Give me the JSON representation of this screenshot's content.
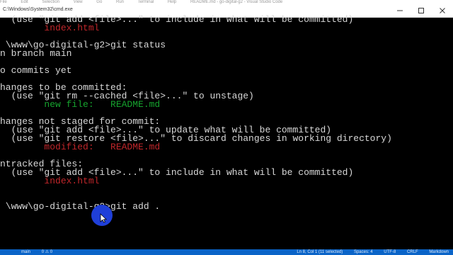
{
  "window": {
    "title": "C:\\Windows\\System32\\cmd.exe",
    "behind_labels": [
      "File",
      "Edit",
      "Selection",
      "View",
      "Go",
      "Run",
      "Terminal",
      "Help",
      "README.md - go-digital-g2 - Visual Studio Code"
    ]
  },
  "console": {
    "lines": [
      {
        "text": "  (use \"git add <file>...\" to include in what will be committed)",
        "color": "default"
      },
      {
        "text": "        index.html",
        "color": "red"
      },
      {
        "text": "",
        "color": "default"
      },
      {
        "text": " \\www\\go-digital-g2>git status",
        "color": "default"
      },
      {
        "text": "n branch main",
        "color": "default"
      },
      {
        "text": "",
        "color": "default"
      },
      {
        "text": "o commits yet",
        "color": "default"
      },
      {
        "text": "",
        "color": "default"
      },
      {
        "text": "hanges to be committed:",
        "color": "default"
      },
      {
        "text": "  (use \"git rm --cached <file>...\" to unstage)",
        "color": "default"
      },
      {
        "text": "        new file:   README.md",
        "color": "green"
      },
      {
        "text": "",
        "color": "default"
      },
      {
        "text": "hanges not staged for commit:",
        "color": "default"
      },
      {
        "text": "  (use \"git add <file>...\" to update what will be committed)",
        "color": "default"
      },
      {
        "text": "  (use \"git restore <file>...\" to discard changes in working directory)",
        "color": "default"
      },
      {
        "text": "        modified:   README.md",
        "color": "red"
      },
      {
        "text": "",
        "color": "default"
      },
      {
        "text": "ntracked files:",
        "color": "default"
      },
      {
        "text": "  (use \"git add <file>...\" to include in what will be committed)",
        "color": "default"
      },
      {
        "text": "        index.html",
        "color": "red"
      },
      {
        "text": "",
        "color": "default"
      },
      {
        "text": "",
        "color": "default"
      },
      {
        "text": " \\www\\go-digital-g2>git add .",
        "color": "default"
      }
    ]
  },
  "statusbar": {
    "left": [
      "main",
      "0 ⚠ 0"
    ],
    "right": [
      "Ln 8, Col 1 (11 selected)",
      "Spaces: 4",
      "UTF-8",
      "CRLF",
      "Markdown"
    ]
  },
  "colors": {
    "background": "#000000",
    "text": "#d8d8d8",
    "green": "#16a32e",
    "red": "#c0262a",
    "taskbar": "#0a64c8",
    "click_indicator": "#1f3fd8"
  }
}
